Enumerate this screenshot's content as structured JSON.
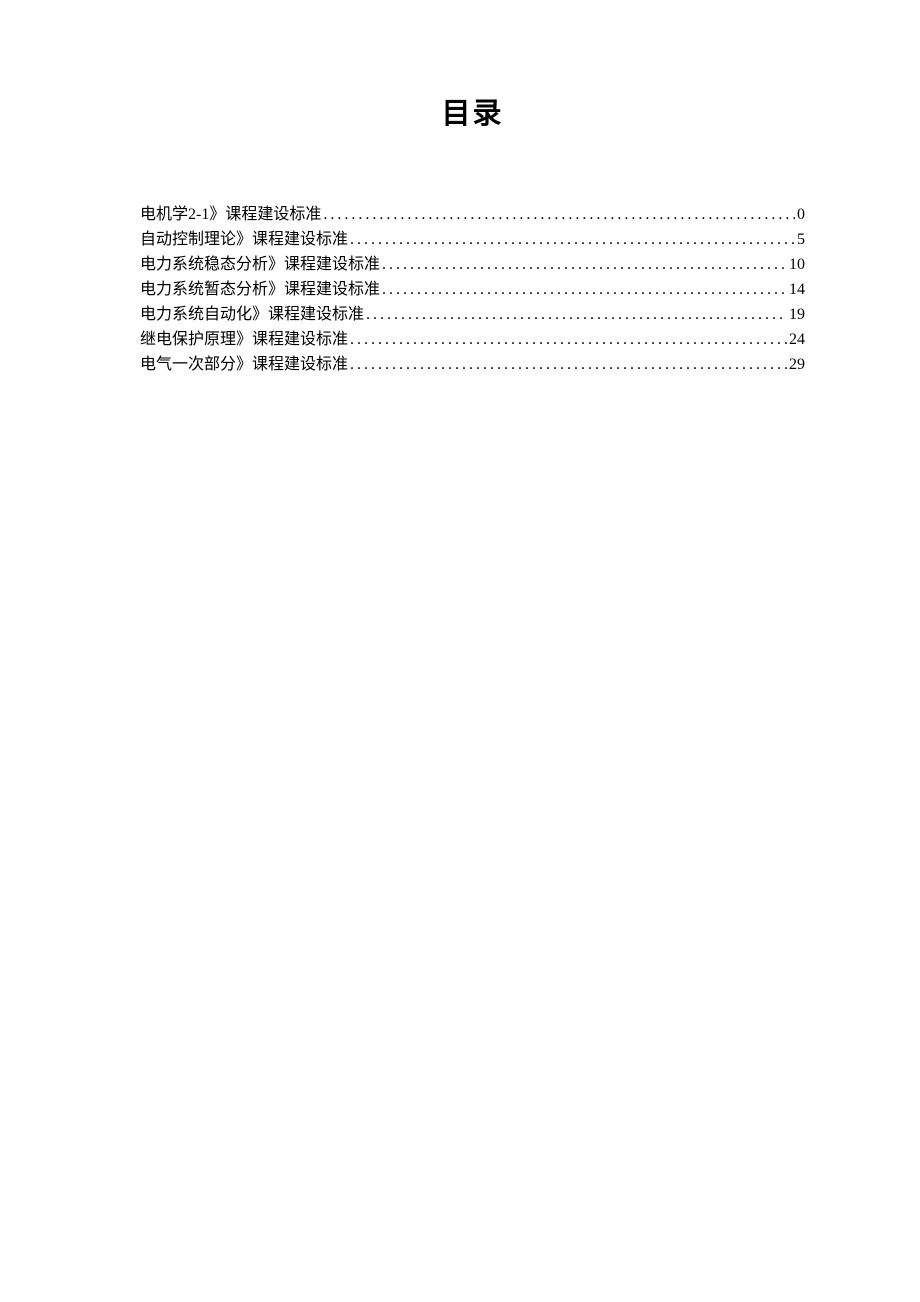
{
  "title": "目录",
  "toc": {
    "entries": [
      {
        "label": "电机学2-1》课程建设标准",
        "page": "0",
        "trailing_space": true
      },
      {
        "label": "自动控制理论》课程建设标准",
        "page": "5",
        "trailing_space": false
      },
      {
        "label": "电力系统稳态分析》课程建设标准",
        "page": "10",
        "trailing_space": false
      },
      {
        "label": "电力系统暂态分析》课程建设标准",
        "page": "14",
        "trailing_space": false
      },
      {
        "label": "电力系统自动化》课程建设标准",
        "page": "19",
        "trailing_space": false
      },
      {
        "label": "继电保护原理》课程建设标准",
        "page": "24",
        "trailing_space": false
      },
      {
        "label": "电气一次部分》课程建设标准",
        "page": "29",
        "trailing_space": false
      }
    ]
  }
}
